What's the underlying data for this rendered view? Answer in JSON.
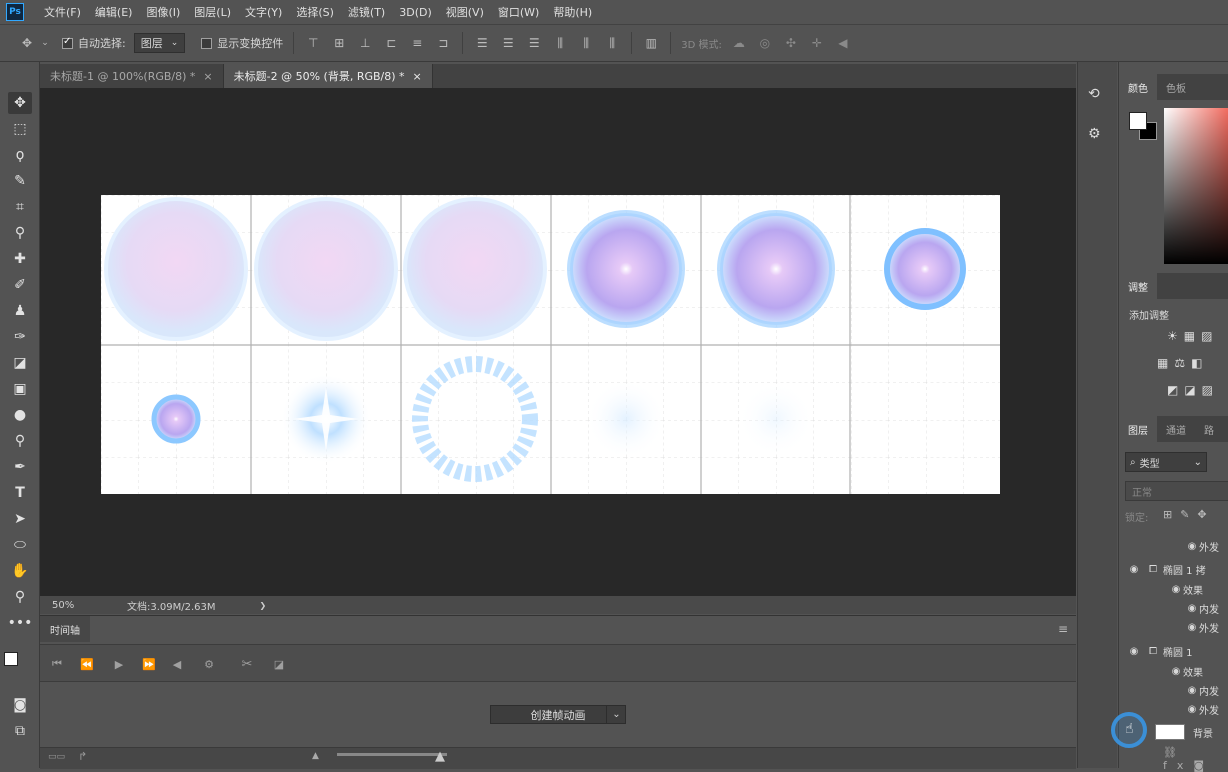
{
  "app": {
    "logo": "Ps"
  },
  "menu": [
    "文件(F)",
    "编辑(E)",
    "图像(I)",
    "图层(L)",
    "文字(Y)",
    "选择(S)",
    "滤镜(T)",
    "3D(D)",
    "视图(V)",
    "窗口(W)",
    "帮助(H)"
  ],
  "options": {
    "auto_select_label": "自动选择:",
    "auto_select_value": "图层",
    "show_transform_label": "显示变换控件",
    "mode_3d_label": "3D 模式:"
  },
  "tabs": [
    {
      "label": "未标题-1 @ 100%(RGB/8) *",
      "close": "×"
    },
    {
      "label": "未标题-2 @ 50% (背景, RGB/8) *",
      "close": "×"
    }
  ],
  "status": {
    "zoom": "50%",
    "doc": "文档:3.09M/2.63M",
    "arrow": "❯"
  },
  "timeline": {
    "tab": "时间轴",
    "create_button": "创建帧动画",
    "dropdown_icon": "chevron-down-icon"
  },
  "panels": {
    "color_tabs": [
      "颜色",
      "色板"
    ],
    "adjust_tab": "调整",
    "adjust_add": "添加调整",
    "layer_tabs": [
      "图层",
      "通道",
      "路"
    ],
    "filter_kind": "类型",
    "blend_mode": "正常",
    "lock_label": "锁定:",
    "layers": [
      {
        "text": "外发",
        "indent": 3
      },
      {
        "text": "椭圆 1 拷",
        "indent": 1
      },
      {
        "text": "效果",
        "indent": 2
      },
      {
        "text": "内发",
        "indent": 3
      },
      {
        "text": "外发",
        "indent": 3
      },
      {
        "text": "椭圆 1",
        "indent": 1
      },
      {
        "text": "效果",
        "indent": 2
      },
      {
        "text": "内发",
        "indent": 3
      },
      {
        "text": "外发",
        "indent": 3
      },
      {
        "text": "背景",
        "indent": 1
      }
    ]
  },
  "colors": {
    "ui_bg": "#535353",
    "canvas_bg": "#282828",
    "accent": "#31a8ff",
    "highlight_ring": "#3b8fd6"
  }
}
